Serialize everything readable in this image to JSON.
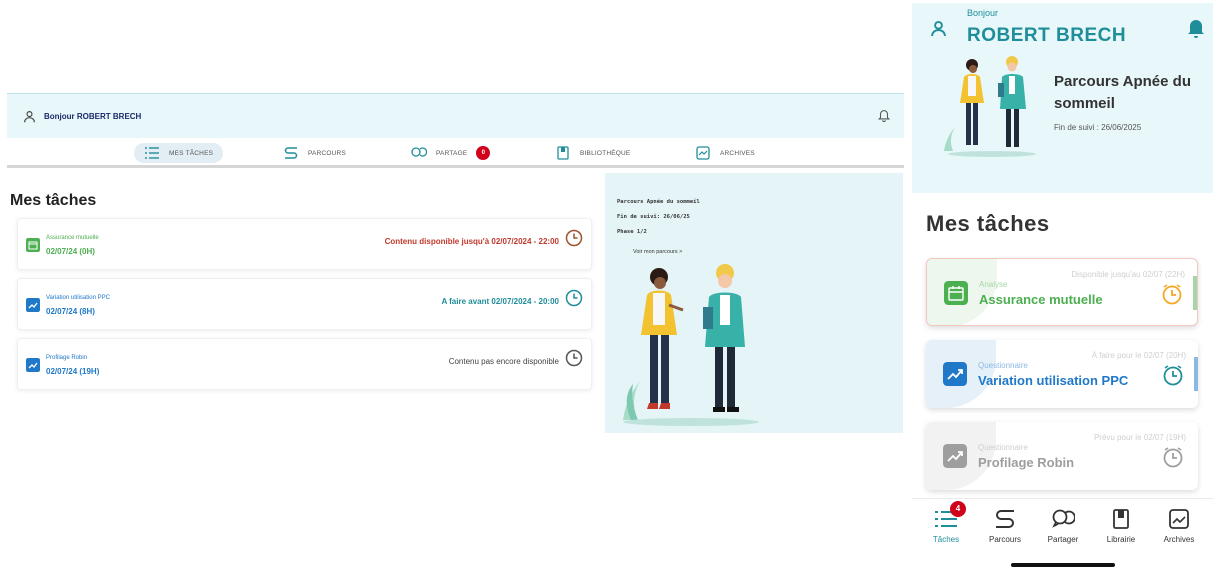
{
  "colors": {
    "teal": "#1e8e9a",
    "green": "#4caf50",
    "alert_red": "#c0392b",
    "blue": "#1f78c8",
    "grey": "#9e9e9e",
    "orange": "#f5a623",
    "badge_red": "#d0021b",
    "header_bg": "#e8f7fa"
  },
  "desktop": {
    "greeting": "Bonjour ROBERT BRECH",
    "nav": [
      {
        "label": "MES TÂCHES",
        "icon": "list-icon"
      },
      {
        "label": "PARCOURS",
        "icon": "route-icon"
      },
      {
        "label": "PARTAGE",
        "icon": "chat-bubbles-icon",
        "badge": "0"
      },
      {
        "label": "BIBLIOTHÈQUE",
        "icon": "book-icon"
      },
      {
        "label": "ARCHIVES",
        "icon": "archive-icon"
      }
    ],
    "title": "Mes tâches",
    "tasks": [
      {
        "category": "Assurance mutuelle",
        "date": "02/07/24 (0H)",
        "status": "Contenu disponible jusqu'à 02/07/2024 - 22:00",
        "icon": "calendar-icon"
      },
      {
        "category": "Variation utilisation PPC",
        "date": "02/07/24 (8H)",
        "status": "A faire avant 02/07/2024 - 20:00",
        "icon": "trend-chart-icon"
      },
      {
        "category": "Profilage Robin",
        "date": "02/07/24 (19H)",
        "status": "Contenu pas encore disponible",
        "icon": "trend-chart-icon"
      }
    ],
    "sidebar": {
      "journey": "Parcours Apnée du sommeil",
      "end_date": "Fin de suivi: 26/06/25",
      "phase": "Phase 1/2",
      "link": "Voir mon parcours >"
    }
  },
  "mobile": {
    "hello": "Bonjour",
    "name": "ROBERT BRECH",
    "journey": "Parcours Apnée du sommeil",
    "end_date": "Fin de suivi : 26/06/2025",
    "title": "Mes tâches",
    "tasks": [
      {
        "category": "Analyse",
        "name": "Assurance mutuelle",
        "due": "Disponible jusqu'au 02/07 (22H)",
        "icon": "calendar-icon"
      },
      {
        "category": "Questionnaire",
        "name": "Variation utilisation PPC",
        "due": "À faire pour le 02/07 (20H)",
        "icon": "trend-chart-icon"
      },
      {
        "category": "Questionnaire",
        "name": "Profilage Robin",
        "due": "Prévu pour le 02/07 (19H)",
        "icon": "trend-chart-icon"
      }
    ],
    "tabs": [
      {
        "label": "Tâches",
        "icon": "list-icon",
        "badge": "4"
      },
      {
        "label": "Parcours",
        "icon": "route-icon"
      },
      {
        "label": "Partager",
        "icon": "chat-bubbles-icon"
      },
      {
        "label": "Librairie",
        "icon": "book-icon"
      },
      {
        "label": "Archives",
        "icon": "archive-icon"
      }
    ]
  }
}
